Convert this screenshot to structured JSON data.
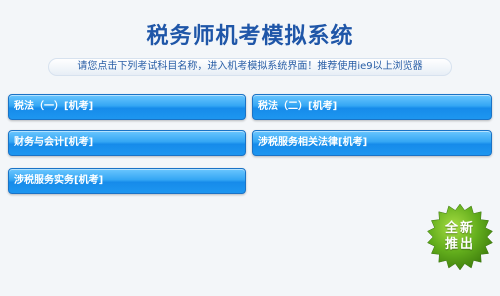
{
  "header": {
    "title": "税务师机考模拟系统",
    "subtitle": "请您点击下列考试科目名称，进入机考模拟系统界面！推荐使用ie9以上浏览器"
  },
  "exams": [
    {
      "label": "税法（一）[机考]"
    },
    {
      "label": "税法（二）[机考]"
    },
    {
      "label": "财务与会计[机考]"
    },
    {
      "label": "涉税服务相关法律[机考]"
    },
    {
      "label": "涉税服务实务[机考]"
    }
  ],
  "badge": {
    "line1": "全新",
    "line2": "推出",
    "icon": "starburst-badge-icon",
    "color": "#5da11b"
  }
}
